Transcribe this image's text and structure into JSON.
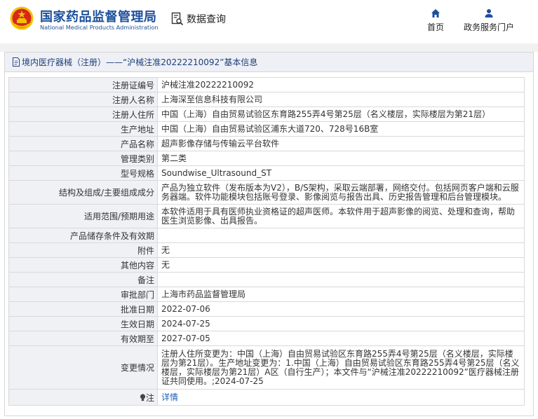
{
  "header": {
    "brand_cn": "国家药品监督管理局",
    "brand_en": "National Medical Products Administration",
    "query_label": "数据查询",
    "nav": [
      {
        "label": "首页",
        "icon": "home-icon"
      },
      {
        "label": "政务服务门户",
        "icon": "user-icon"
      }
    ]
  },
  "panel": {
    "title": "境内医疗器械（注册）——“沪械注准20222210092”基本信息"
  },
  "rows": [
    {
      "label": "注册证编号",
      "value": "沪械注准20222210092"
    },
    {
      "label": "注册人名称",
      "value": "上海深至信息科技有限公司"
    },
    {
      "label": "注册人住所",
      "value": "中国（上海）自由贸易试验区东育路255弄4号第25层（名义楼层，实际楼层为第21层）"
    },
    {
      "label": "生产地址",
      "value": "中国（上海）自由贸易试验区浦东大道720、728号16B室"
    },
    {
      "label": "产品名称",
      "value": "超声影像存储与传输云平台软件"
    },
    {
      "label": "管理类别",
      "value": "第二类"
    },
    {
      "label": "型号规格",
      "value": "Soundwise_Ultrasound_ST"
    },
    {
      "label": "结构及组成/主要组成成分",
      "value": "产品为独立软件（发布版本为V2），B/S架构，采取云端部署，网络交付。包括网页客户端和云服务器端。软件功能模块包括账号登录、影像阅览与报告出具、历史报告管理和后台管理模块。"
    },
    {
      "label": "适用范围/预期用途",
      "value": "本软件适用于具有医师执业资格证的超声医师。本软件用于超声影像的阅览、处理和查询，帮助医生浏览影像、出具报告。"
    },
    {
      "label": "产品储存条件及有效期",
      "value": ""
    },
    {
      "label": "附件",
      "value": "无"
    },
    {
      "label": "其他内容",
      "value": "无"
    },
    {
      "label": "备注",
      "value": ""
    },
    {
      "label": "审批部门",
      "value": "上海市药品监督管理局"
    },
    {
      "label": "批准日期",
      "value": "2022-07-06"
    },
    {
      "label": "生效日期",
      "value": "2024-07-25"
    },
    {
      "label": "有效期至",
      "value": "2027-07-05"
    },
    {
      "label": "变更情况",
      "value": "注册人住所变更为：中国（上海）自由贸易试验区东育路255弄4号第25层（名义楼层，实际楼层为第21层）。生产地址变更为：1.中国（上海）自由贸易试验区东育路255弄4号第25层（名义楼层，实际楼层为第21层）A区（自行生产）；本文件与“沪械注准20222210092”医疗器械注册证共同使用。;2024-07-25"
    },
    {
      "label": "注",
      "value": "详情",
      "icon": "lightbulb-icon"
    }
  ],
  "colors": {
    "brand_blue": "#1c4f9c",
    "label_bg": "#eff1f4",
    "title_bg": "#eef0f5",
    "link_blue": "#1e5fb5",
    "emblem_red": "#d7261e",
    "emblem_gold": "#f2c200"
  }
}
